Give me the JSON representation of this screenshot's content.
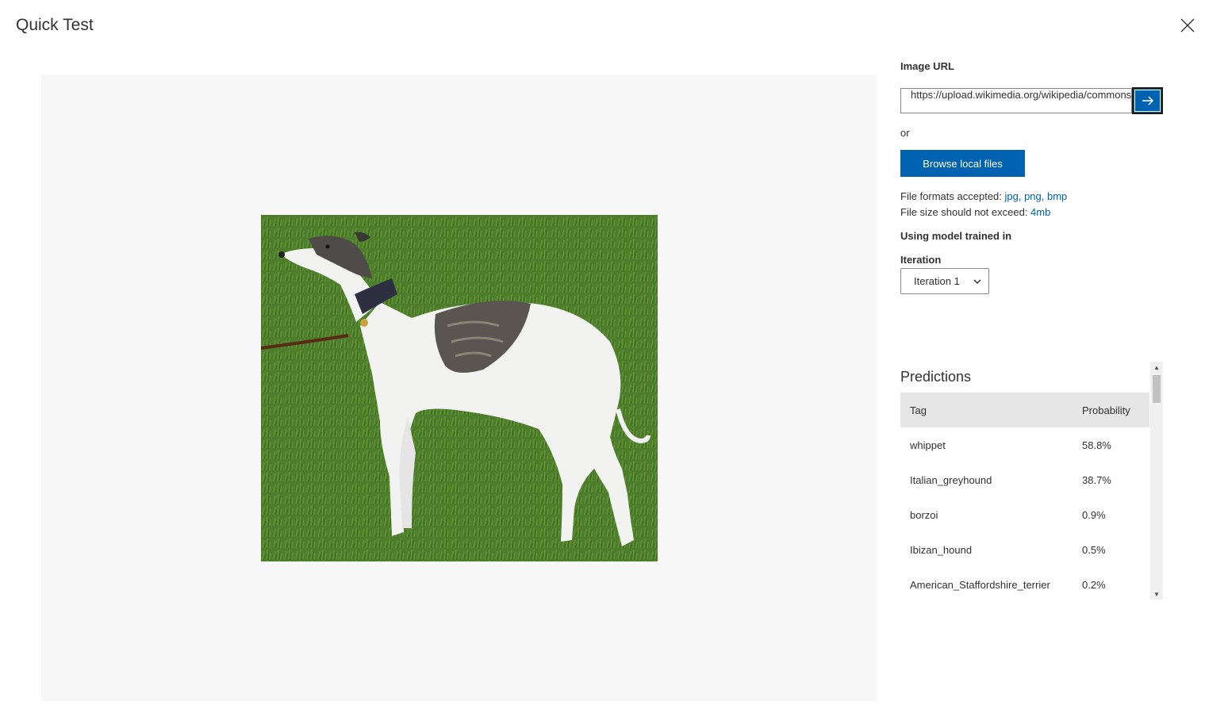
{
  "dialog": {
    "title": "Quick Test"
  },
  "preview": {
    "image_alt": "Whippet dog standing on grass"
  },
  "image_url": {
    "label": "Image URL",
    "value": "https://upload.wikimedia.org/wikipedia/commons/",
    "submit_icon": "arrow-right-icon"
  },
  "or_text": "or",
  "browse": {
    "label": "Browse local files"
  },
  "formats": {
    "prefix": "File formats accepted: ",
    "types": "jpg, png, bmp",
    "size_prefix": "File size should not exceed: ",
    "size": "4mb"
  },
  "model": {
    "label": "Using model trained in",
    "iteration_label": "Iteration",
    "iteration_value": "Iteration 1"
  },
  "predictions": {
    "title": "Predictions",
    "columns": [
      "Tag",
      "Probability"
    ],
    "rows": [
      {
        "tag": "whippet",
        "probability": "58.8%"
      },
      {
        "tag": "Italian_greyhound",
        "probability": "38.7%"
      },
      {
        "tag": "borzoi",
        "probability": "0.9%"
      },
      {
        "tag": "Ibizan_hound",
        "probability": "0.5%"
      },
      {
        "tag": "American_Staffordshire_terrier",
        "probability": "0.2%"
      }
    ]
  },
  "colors": {
    "accent": "#0063b1",
    "table_header_bg": "#e6e6e6",
    "preview_bg": "#f7f7f7"
  }
}
